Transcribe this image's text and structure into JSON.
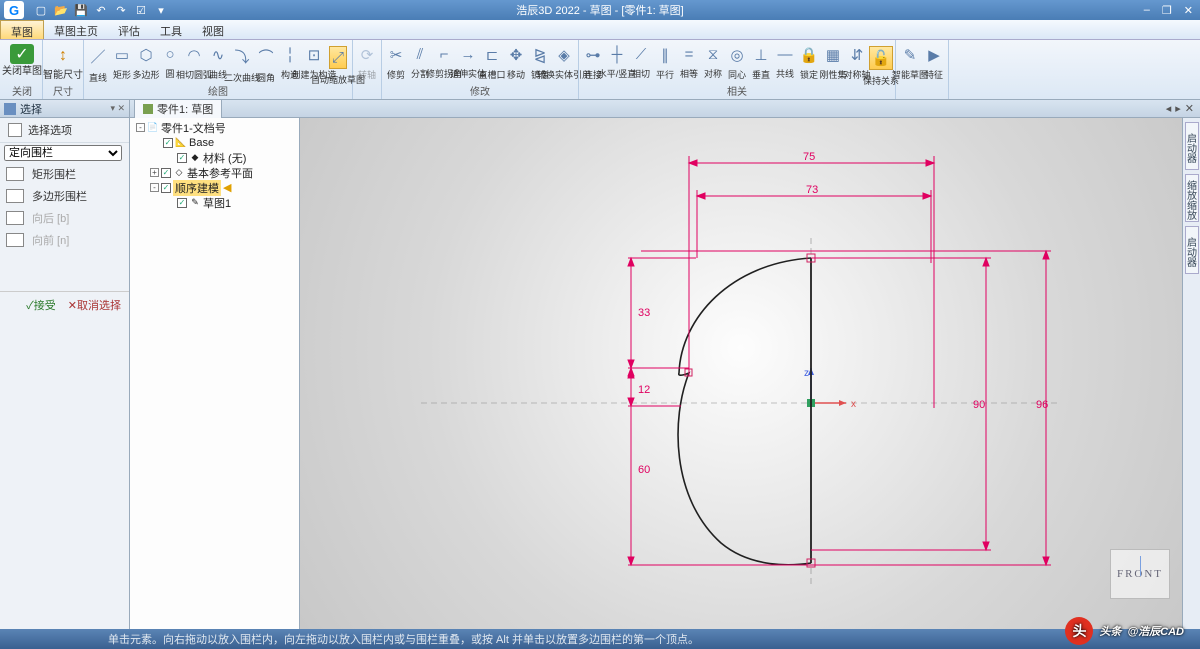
{
  "app": {
    "title": "浩辰3D 2022 - 草图 - [零件1: 草图]",
    "logo": "G"
  },
  "qat": [
    "new",
    "open",
    "save",
    "undo",
    "redo",
    "print",
    "options"
  ],
  "winctrls": [
    "–",
    "❐",
    "✕",
    "–",
    "❐",
    "✕"
  ],
  "menus": [
    {
      "label": "草图",
      "active": true
    },
    {
      "label": "草图主页",
      "active": false
    },
    {
      "label": "评估",
      "active": false
    },
    {
      "label": "工具",
      "active": false
    },
    {
      "label": "视图",
      "active": false
    }
  ],
  "ribbon": {
    "g_close": {
      "label": "关闭",
      "btns": [
        {
          "lbl": "关闭草图",
          "ico": "✓",
          "big": true,
          "color": "#3a9a3a"
        }
      ]
    },
    "g_dim": {
      "label": "尺寸",
      "btns": [
        {
          "lbl": "智能尺寸",
          "ico": "↕",
          "big": true,
          "color": "#d08000"
        }
      ]
    },
    "g_draw": {
      "label": "绘图",
      "btns": [
        {
          "lbl": "直线",
          "ico": "／"
        },
        {
          "lbl": "矩形",
          "ico": "▭"
        },
        {
          "lbl": "多边形",
          "ico": "⬡"
        },
        {
          "lbl": "圆",
          "ico": "○"
        },
        {
          "lbl": "相切圆弧",
          "ico": "◠"
        },
        {
          "lbl": "曲线",
          "ico": "∿"
        },
        {
          "lbl": "二次曲线",
          "ico": "⤵"
        },
        {
          "lbl": "圆角",
          "ico": "⌒"
        },
        {
          "lbl": "构造",
          "ico": "╎"
        },
        {
          "lbl": "创建为构造",
          "ico": "⊡"
        },
        {
          "lbl": "自动缩放草图",
          "ico": "⤢",
          "active": true
        }
      ]
    },
    "g_tan": {
      "label": "",
      "btns": [
        {
          "lbl": "转轴",
          "ico": "⟳",
          "disabled": true
        }
      ]
    },
    "g_mod": {
      "label": "修改",
      "btns": [
        {
          "lbl": "修剪",
          "ico": "✂"
        },
        {
          "lbl": "分割",
          "ico": "⫽"
        },
        {
          "lbl": "修剪拐角",
          "ico": "⌐"
        },
        {
          "lbl": "延伸实体",
          "ico": "→"
        },
        {
          "lbl": "直槽口",
          "ico": "⊏"
        },
        {
          "lbl": "移动",
          "ico": "✥"
        },
        {
          "lbl": "镜像",
          "ico": "⧎"
        },
        {
          "lbl": "转换实体引用",
          "ico": "◈"
        }
      ]
    },
    "g_rel": {
      "label": "相关",
      "btns": [
        {
          "lbl": "连接",
          "ico": "⊶"
        },
        {
          "lbl": "水平/竖直",
          "ico": "┼"
        },
        {
          "lbl": "相切",
          "ico": "⟋"
        },
        {
          "lbl": "平行",
          "ico": "∥"
        },
        {
          "lbl": "相等",
          "ico": "="
        },
        {
          "lbl": "对称",
          "ico": "⧖"
        },
        {
          "lbl": "同心",
          "ico": "◎"
        },
        {
          "lbl": "垂直",
          "ico": "⊥"
        },
        {
          "lbl": "共线",
          "ico": "—"
        },
        {
          "lbl": "锁定",
          "ico": "🔒"
        },
        {
          "lbl": "刚性集",
          "ico": "▦"
        },
        {
          "lbl": "对称轴",
          "ico": "⇵"
        },
        {
          "lbl": "保持关系",
          "ico": "🔓",
          "active": true
        }
      ]
    },
    "g_sm": {
      "label": "",
      "btns": [
        {
          "lbl": "智能草图",
          "ico": "✎"
        },
        {
          "lbl": "特征",
          "ico": "▶"
        }
      ]
    }
  },
  "leftpanel": {
    "title": "选择",
    "opt_header": "选择选项",
    "mode_label": "定向围栏",
    "items": [
      {
        "label": "矩形围栏",
        "ico": "rect"
      },
      {
        "label": "多边形围栏",
        "ico": "poly"
      },
      {
        "label": "向后  [b]",
        "ico": "arrow",
        "disabled": true
      },
      {
        "label": "向前  [n]",
        "ico": "arrow",
        "disabled": true
      }
    ],
    "accept": "✓接受",
    "cancel": "✕取消选择"
  },
  "doctab": {
    "label": "零件1: 草图"
  },
  "tree": [
    {
      "indent": 0,
      "exp": "-",
      "ico": "📄",
      "label": "零件1-文档号",
      "chk": false
    },
    {
      "indent": 1,
      "exp": "",
      "ico": "📐",
      "label": "Base",
      "chk": true
    },
    {
      "indent": 2,
      "exp": "",
      "ico": "◆",
      "label": "材料 (无)",
      "chk": true
    },
    {
      "indent": 1,
      "exp": "+",
      "ico": "◇",
      "label": "基本参考平面",
      "chk": true
    },
    {
      "indent": 1,
      "exp": "-",
      "ico": "",
      "label": "顺序建模",
      "chk": true,
      "highlight": true,
      "arrow": true
    },
    {
      "indent": 2,
      "exp": "",
      "ico": "✎",
      "label": "草图1",
      "chk": true
    }
  ],
  "dimensions": {
    "d75": "75",
    "d73": "73",
    "d33": "33",
    "d12": "12",
    "d60": "60",
    "d90": "90",
    "d96": "96"
  },
  "axes": {
    "x": "x",
    "z": "z"
  },
  "viewcube": "FRONT",
  "rightbar": [
    "启动器",
    "缩放缩放",
    "启动器"
  ],
  "status": "单击元素。向右拖动以放入围栏内，向左拖动以放入围栏内或与围栏重叠，或按 Alt 并单击以放置多边围栏的第一个顶点。",
  "watermark": {
    "prefix": "头条",
    "brand": "@浩辰CAD"
  }
}
